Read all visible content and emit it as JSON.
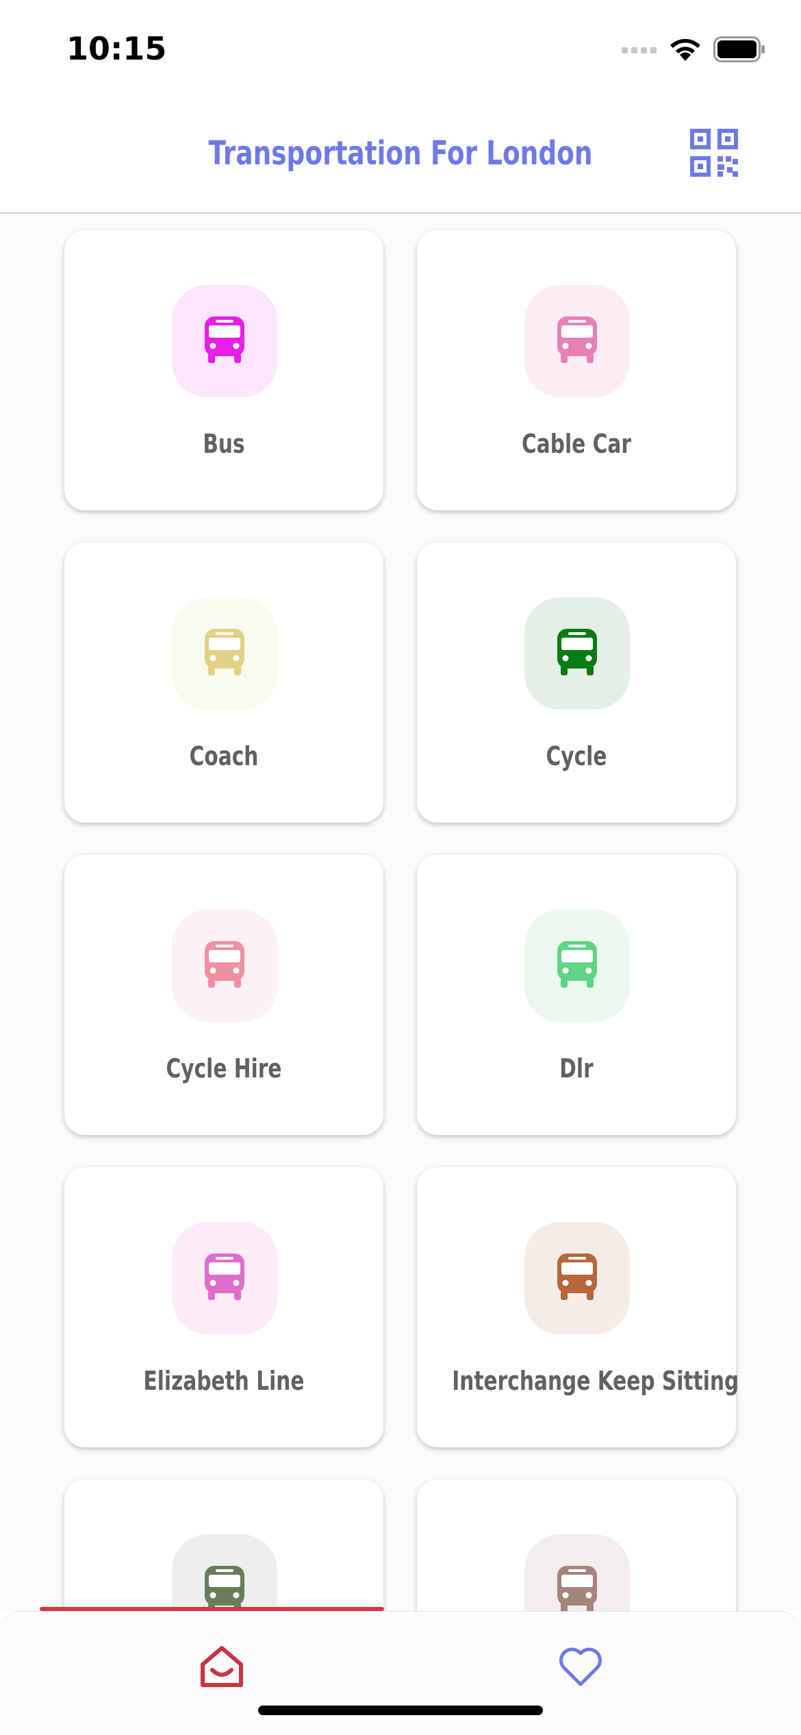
{
  "status_bar": {
    "time": "10:15"
  },
  "header": {
    "title": "Transportation For London"
  },
  "modes": [
    {
      "label": "Bus",
      "icon": "bus-icon",
      "icon_color": "#e61ee6",
      "tile_color": "#fce6fc"
    },
    {
      "label": "Cable Car",
      "icon": "bus-icon",
      "icon_color": "#e97fb7",
      "tile_color": "#fcedf4"
    },
    {
      "label": "Coach",
      "icon": "bus-icon",
      "icon_color": "#e2d184",
      "tile_color": "#fafaef"
    },
    {
      "label": "Cycle",
      "icon": "bus-icon",
      "icon_color": "#0a7c14",
      "tile_color": "#e5efe5"
    },
    {
      "label": "Cycle Hire",
      "icon": "bus-icon",
      "icon_color": "#ef8fa2",
      "tile_color": "#fcf1f3"
    },
    {
      "label": "Dlr",
      "icon": "bus-icon",
      "icon_color": "#5fd484",
      "tile_color": "#ebf8ee"
    },
    {
      "label": "Elizabeth Line",
      "icon": "bus-icon",
      "icon_color": "#e06ccc",
      "tile_color": "#fbecf8"
    },
    {
      "label": "Interchange Keep Sitting",
      "icon": "bus-icon",
      "icon_color": "#b7673a",
      "tile_color": "#f4ece7"
    },
    {
      "label": "",
      "icon": "bus-icon",
      "icon_color": "#6a7d5b",
      "tile_color": "#eeeeec"
    },
    {
      "label": "",
      "icon": "bus-icon",
      "icon_color": "#a4857c",
      "tile_color": "#f1eeed"
    }
  ],
  "tab_bar": {
    "tabs": [
      {
        "name": "home",
        "icon": "home-icon",
        "color": "#c73443"
      },
      {
        "name": "favorites",
        "icon": "heart-icon",
        "color": "#6e79e9"
      }
    ]
  },
  "colors": {
    "accent": "#6e79e9",
    "active_tab": "#d0384a"
  }
}
